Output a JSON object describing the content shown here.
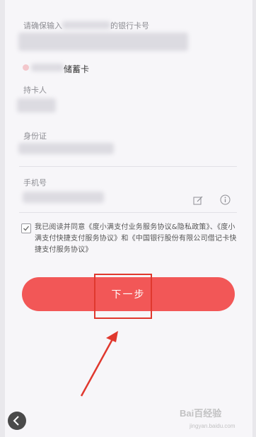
{
  "card_section": {
    "prompt": "请确保输入",
    "prompt_tail": "的银行卡号",
    "card_type": "储蓄卡"
  },
  "fields": [
    {
      "label": "持卡人"
    },
    {
      "label": "身份证"
    },
    {
      "label": "手机号"
    }
  ],
  "agreement": {
    "checked": true,
    "text": "我已阅读并同意《度小满支付业务服务协议&隐私政策》、《度小满支付快捷支付服务协议》和《中国银行股份有限公司借记卡快捷支付服务协议》"
  },
  "next_button": {
    "label": "下一步",
    "color": "#f25757"
  },
  "annotation": {
    "color": "#e0382e"
  },
  "watermark": {
    "logo": "Bai百经验",
    "sub": "jingyan.baidu.com"
  },
  "icons": [
    "edit-icon",
    "info-icon",
    "back-icon",
    "check-icon"
  ]
}
